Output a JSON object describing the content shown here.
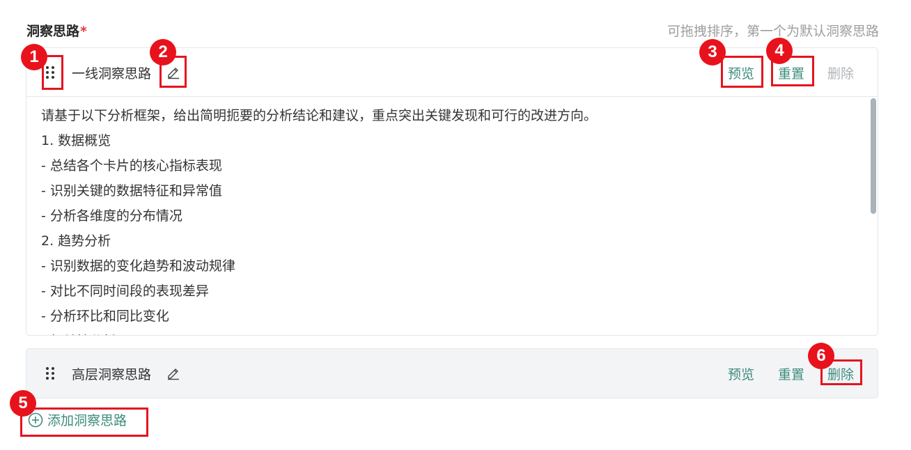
{
  "section": {
    "title": "洞察思路",
    "required_mark": "*",
    "hint": "可拖拽排序，第一个为默认洞察思路"
  },
  "cards": [
    {
      "name": "一线洞察思路",
      "actions": {
        "preview": "预览",
        "reset": "重置",
        "delete": "删除"
      },
      "delete_disabled": true,
      "content_lines": [
        "请基于以下分析框架，给出简明扼要的分析结论和建议，重点突出关键发现和可行的改进方向。",
        "1. 数据概览",
        "- 总结各个卡片的核心指标表现",
        "- 识别关键的数据特征和异常值",
        "- 分析各维度的分布情况",
        "2. 趋势分析",
        "- 识别数据的变化趋势和波动规律",
        "- 对比不同时间段的表现差异",
        "- 分析环比和同比变化",
        "- 相关性分析"
      ]
    },
    {
      "name": "高层洞察思路",
      "actions": {
        "preview": "预览",
        "reset": "重置",
        "delete": "删除"
      },
      "delete_disabled": false
    }
  ],
  "add_button": {
    "label": "添加洞察思路",
    "icon": "plus-circle-icon"
  },
  "annotations": [
    "1",
    "2",
    "3",
    "4",
    "5",
    "6"
  ],
  "colors": {
    "accent": "#3d8c7c",
    "disabled": "#b0b4ba",
    "required": "#e53935",
    "annotation": "#e5141e"
  }
}
